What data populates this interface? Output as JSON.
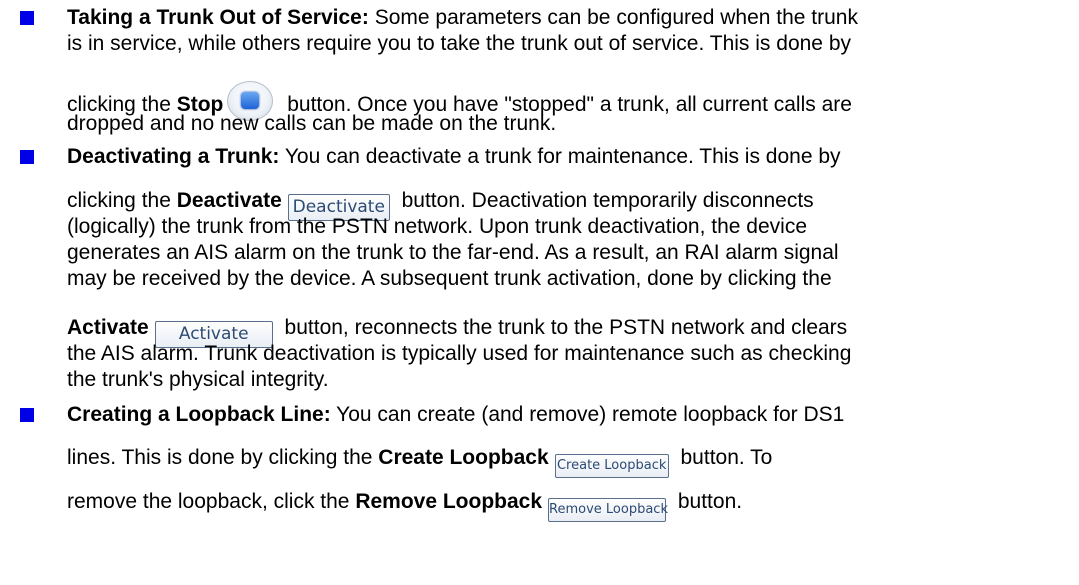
{
  "item1": {
    "title": "Taking a Trunk Out of Service:",
    "l1_rest": " Some parameters can be configured when the trunk",
    "l2": "is in service, while others require you to take the trunk out of service. This is done by",
    "l3_pre": "clicking the ",
    "l3_bold": "Stop",
    "l3_post": " button. Once you have \"stopped\" a trunk, all current calls are",
    "l4": "dropped and no new calls can be made on the trunk."
  },
  "item2": {
    "title": "Deactivating a Trunk:",
    "l1_rest": " You can deactivate a trunk for maintenance. This is done by",
    "l2_pre": "clicking the ",
    "l2_bold": "Deactivate",
    "l2_post": " button. Deactivation temporarily disconnects",
    "l3": "(logically) the trunk from the PSTN network. Upon trunk deactivation, the device",
    "l4": "generates an AIS alarm on the trunk to the far-end. As a result, an RAI alarm signal",
    "l5": "may be received by the device. A subsequent trunk activation, done by clicking the",
    "l6_bold": "Activate",
    "l6_post": " button, reconnects the trunk to the PSTN network and clears",
    "l7": "the AIS alarm. Trunk deactivation is typically used for maintenance such as checking",
    "l8": "the trunk's physical integrity."
  },
  "item3": {
    "title": "Creating a Loopback Line:",
    "l1_rest": " You can create (and remove) remote loopback for DS1",
    "l2_pre": "lines. This is done by clicking the ",
    "l2_bold": "Create Loopback",
    "l2_post": " button. To",
    "l3_pre": "remove the loopback, click the ",
    "l3_bold": "Remove Loopback",
    "l3_post": " button."
  },
  "buttons": {
    "deactivate": "Deactivate",
    "activate": "Activate",
    "create_loopback": "Create Loopback",
    "remove_loopback": "Remove Loopback"
  },
  "colors": {
    "bullet": "#0000e6",
    "button_text": "#2d4a73",
    "button_border": "#5a6f8c"
  },
  "icons": {
    "stop_button": "stop-icon"
  }
}
